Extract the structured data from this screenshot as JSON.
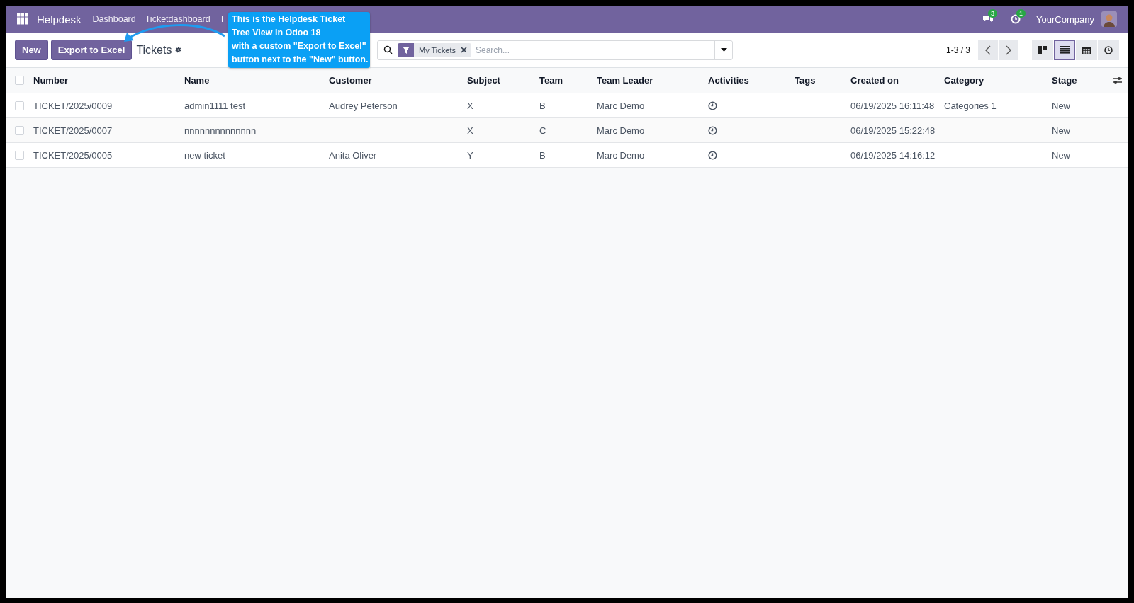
{
  "navbar": {
    "app_name": "Helpdesk",
    "menu": [
      "Dashboard",
      "Ticketdashboard",
      "T"
    ],
    "messages_badge": "3",
    "activities_badge": "1",
    "company": "YourCompany"
  },
  "control_panel": {
    "buttons": [
      "New",
      "Export to Excel"
    ],
    "breadcrumb": "Tickets",
    "search": {
      "facet": "My Tickets",
      "placeholder": "Search..."
    },
    "pager": "1-3 / 3",
    "views": [
      {
        "kind": "kanban",
        "selected": false
      },
      {
        "kind": "list",
        "selected": true
      },
      {
        "kind": "calendar",
        "selected": false
      },
      {
        "kind": "activity",
        "selected": false
      }
    ]
  },
  "table": {
    "header_checked": false,
    "columns": [
      "Number",
      "Name",
      "Customer",
      "Subject",
      "Team",
      "Team Leader",
      "Activities",
      "Tags",
      "Created on",
      "Category",
      "Stage"
    ],
    "rows": [
      {
        "checked": false,
        "number": "TICKET/2025/0009",
        "name": "admin1111 test",
        "customer": "Audrey Peterson",
        "subject": "X",
        "team": "B",
        "team_leader": "Marc Demo",
        "created_on": "06/19/2025 16:11:48",
        "category": "Categories 1",
        "stage": "New"
      },
      {
        "checked": false,
        "number": "TICKET/2025/0007",
        "name": "nnnnnnnnnnnnnn",
        "subject": "X",
        "team": "C",
        "team_leader": "Marc Demo",
        "created_on": "06/19/2025 15:22:48",
        "stage": "New"
      },
      {
        "checked": false,
        "number": "TICKET/2025/0005",
        "name": "new ticket",
        "customer": "Anita Oliver",
        "subject": "Y",
        "team": "B",
        "team_leader": "Marc Demo",
        "created_on": "06/19/2025 14:16:12",
        "stage": "New"
      }
    ]
  },
  "annotation": {
    "lines": [
      "This is the Helpdesk Ticket",
      "Tree View in Odoo 18",
      "with a custom \"Export to Excel\"",
      " button next to the \"New\" button."
    ]
  }
}
